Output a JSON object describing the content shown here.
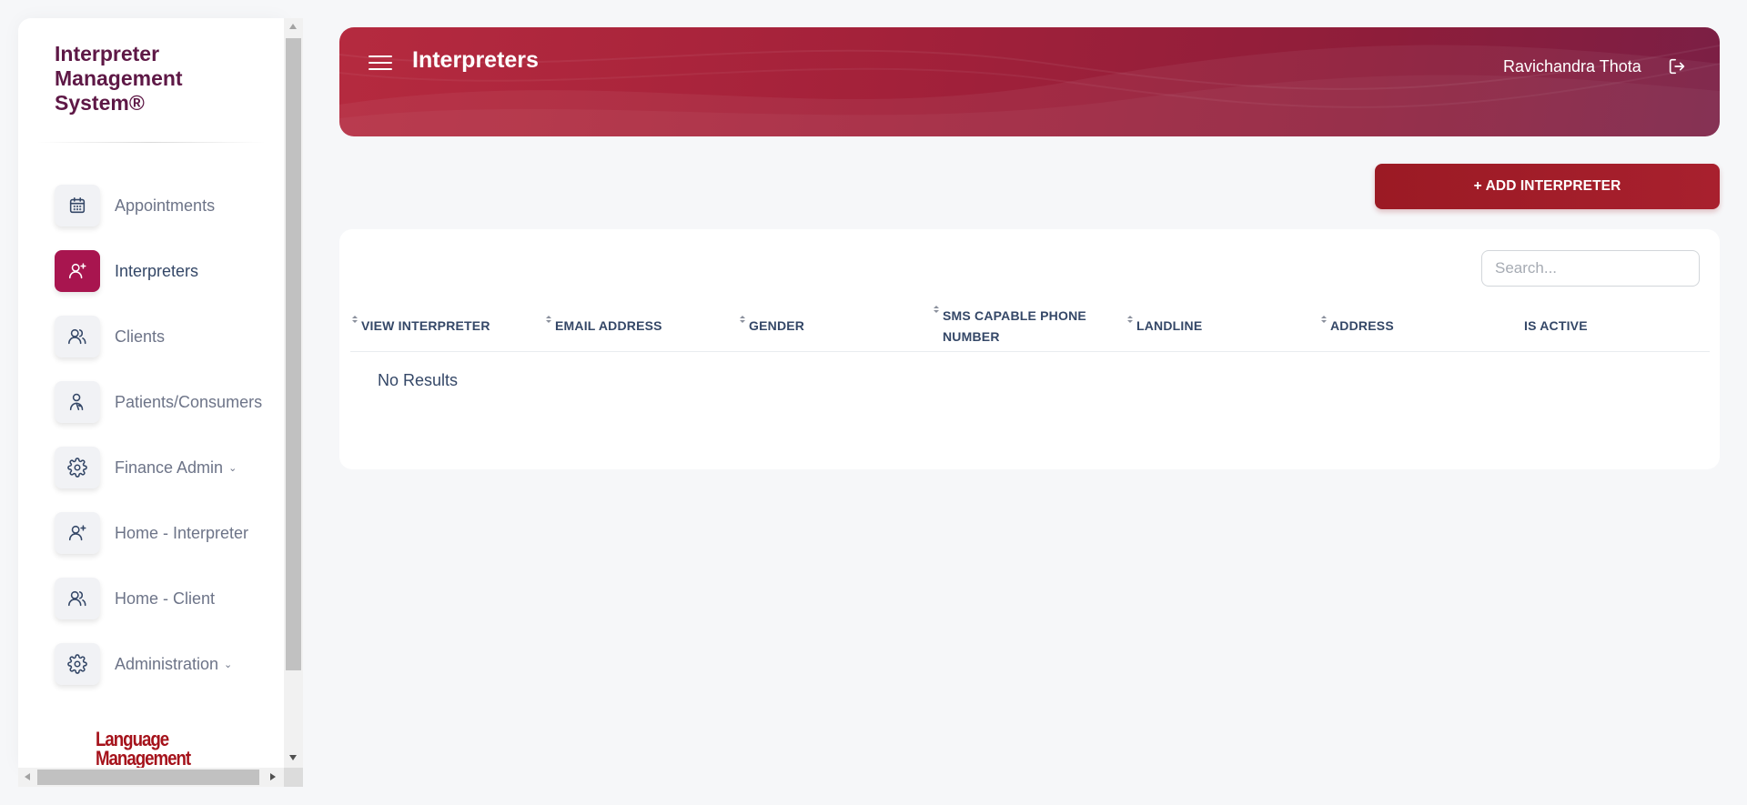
{
  "sidebar": {
    "brand": "Interpreter Management System®",
    "items": [
      {
        "label": "Appointments",
        "icon": "calendar-icon",
        "active": false
      },
      {
        "label": "Interpreters",
        "icon": "user-plus-icon",
        "active": true
      },
      {
        "label": "Clients",
        "icon": "users-icon",
        "active": false
      },
      {
        "label": "Patients/Consumers",
        "icon": "person-walking-icon",
        "active": false
      },
      {
        "label": "Finance Admin",
        "icon": "gear-icon",
        "active": false,
        "has_dropdown": true
      },
      {
        "label": "Home - Interpreter",
        "icon": "user-plus-icon",
        "active": false
      },
      {
        "label": "Home - Client",
        "icon": "users-icon",
        "active": false
      },
      {
        "label": "Administration",
        "icon": "gear-icon",
        "active": false,
        "has_dropdown": true
      }
    ],
    "logo_line1": "Language",
    "logo_line2": "Management"
  },
  "header": {
    "title": "Interpreters",
    "user_name": "Ravichandra Thota",
    "menu_icon": "hamburger-menu-icon",
    "logout_icon": "logout-icon"
  },
  "actions": {
    "add_label": "+ ADD INTERPRETER"
  },
  "table": {
    "search_placeholder": "Search...",
    "columns": [
      {
        "label": "VIEW INTERPRETER",
        "sortable": true
      },
      {
        "label": "EMAIL ADDRESS",
        "sortable": true
      },
      {
        "label": "GENDER",
        "sortable": true
      },
      {
        "label": "SMS CAPABLE PHONE NUMBER",
        "sortable": true
      },
      {
        "label": "LANDLINE",
        "sortable": true
      },
      {
        "label": "ADDRESS",
        "sortable": true
      },
      {
        "label": "IS ACTIVE",
        "sortable": false
      }
    ],
    "empty_text": "No Results"
  },
  "colors": {
    "brand_text": "#5e1846",
    "active_nav": "#a8154f",
    "header_gradient_start": "#b52a3f",
    "header_gradient_end": "#7b1f45",
    "add_button": "#9b1a24",
    "logo_red": "#a5121b"
  }
}
